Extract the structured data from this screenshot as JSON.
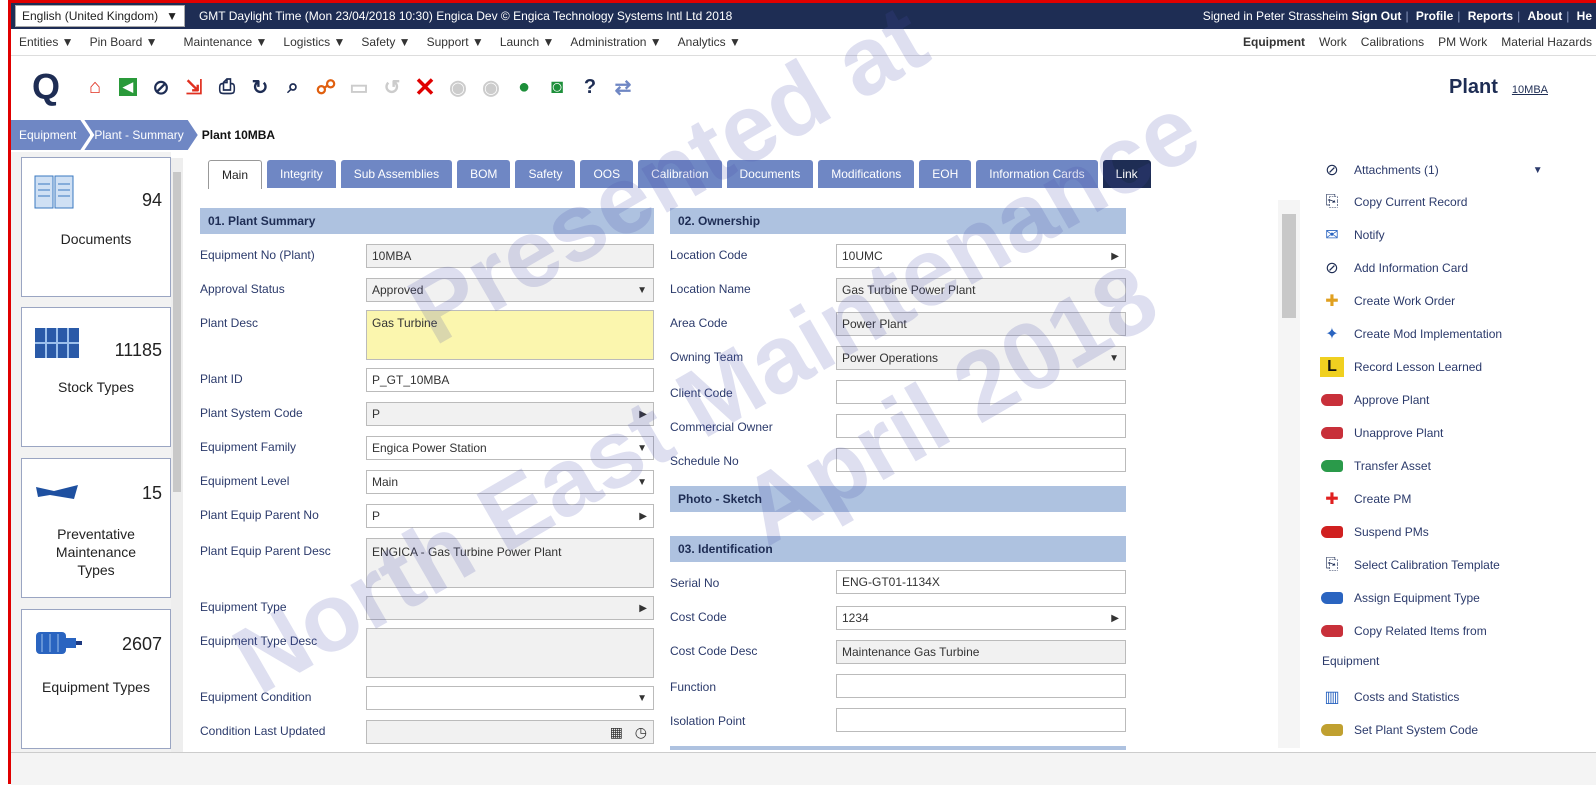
{
  "topbar": {
    "language": "English (United Kingdom)",
    "timezone_info": "GMT Daylight Time (Mon 23/04/2018 10:30) Engica Dev © Engica Technology Systems Intl Ltd 2018",
    "signed_in": "Signed in Peter Strassheim",
    "sign_out": "Sign Out",
    "profile": "Profile",
    "reports": "Reports",
    "about": "About",
    "help": "He"
  },
  "menubar": {
    "left": [
      "Entities ▼",
      "Pin Board ▼",
      "Maintenance ▼",
      "Logistics ▼",
      "Safety ▼",
      "Support ▼",
      "Launch ▼",
      "Administration ▼",
      "Analytics ▼"
    ],
    "right": [
      "Equipment",
      "Work",
      "Calibrations",
      "PM Work",
      "Material Hazards"
    ]
  },
  "toolbar": {
    "logo": "Q",
    "page_title": "Plant",
    "page_subtitle": "10MBA"
  },
  "breadcrumb": [
    "Equipment",
    "Plant - Summary",
    "Plant 10MBA"
  ],
  "tiles": [
    {
      "count": "94",
      "name": "Documents"
    },
    {
      "count": "11185",
      "name": "Stock Types"
    },
    {
      "count": "15",
      "name": "Preventative Maintenance Types"
    },
    {
      "count": "2607",
      "name": "Equipment Types"
    }
  ],
  "tabs": [
    "Main",
    "Integrity",
    "Sub Assemblies",
    "BOM",
    "Safety",
    "OOS",
    "Calibration",
    "Documents",
    "Modifications",
    "EOH",
    "Information Cards",
    "Link"
  ],
  "summary": {
    "title": "01. Plant Summary",
    "equipment_no_label": "Equipment No (Plant)",
    "equipment_no": "10MBA",
    "approval_status_label": "Approval Status",
    "approval_status": "Approved",
    "plant_desc_label": "Plant Desc",
    "plant_desc": "Gas Turbine",
    "plant_id_label": "Plant ID",
    "plant_id": "P_GT_10MBA",
    "plant_system_code_label": "Plant System Code",
    "plant_system_code": "P",
    "equipment_family_label": "Equipment Family",
    "equipment_family": "Engica Power Station",
    "equipment_level_label": "Equipment Level",
    "equipment_level": "Main",
    "parent_no_label": "Plant Equip Parent No",
    "parent_no": "P",
    "parent_desc_label": "Plant Equip Parent Desc",
    "parent_desc": "ENGICA - Gas Turbine Power Plant",
    "equipment_type_label": "Equipment Type",
    "equipment_type": "",
    "equipment_type_desc_label": "Equipment Type Desc",
    "equipment_type_desc": "",
    "equipment_condition_label": "Equipment Condition",
    "equipment_condition": "",
    "condition_updated_label": "Condition Last Updated",
    "condition_updated": ""
  },
  "ownership": {
    "title": "02. Ownership",
    "location_code_label": "Location Code",
    "location_code": "10UMC",
    "location_name_label": "Location Name",
    "location_name": "Gas Turbine Power Plant",
    "area_code_label": "Area Code",
    "area_code": "Power Plant",
    "owning_team_label": "Owning Team",
    "owning_team": "Power Operations",
    "client_code_label": "Client Code",
    "client_code": "",
    "commercial_owner_label": "Commercial Owner",
    "commercial_owner": "",
    "schedule_no_label": "Schedule No",
    "schedule_no": ""
  },
  "photo": {
    "title": "Photo - Sketch"
  },
  "identification": {
    "title": "03. Identification",
    "serial_no_label": "Serial No",
    "serial_no": "ENG-GT01-1134X",
    "cost_code_label": "Cost Code",
    "cost_code": "1234",
    "cost_code_desc_label": "Cost Code Desc",
    "cost_code_desc": "Maintenance Gas Turbine",
    "function_label": "Function",
    "function": "",
    "isolation_point_label": "Isolation Point",
    "isolation_point": ""
  },
  "actions": [
    "Attachments (1)",
    "Copy Current Record",
    "Notify",
    "Add Information Card",
    "Create Work Order",
    "Create Mod Implementation",
    "Record Lesson Learned",
    "Approve Plant",
    "Unapprove Plant",
    "Transfer Asset",
    "Create PM",
    "Suspend PMs",
    "Select Calibration Template",
    "Assign Equipment Type",
    "Copy Related Items from",
    "Equipment",
    "Costs and Statistics",
    "Set Plant System Code"
  ],
  "watermark": [
    "Presented at",
    "North East Maintenance",
    "April 2018"
  ],
  "colors": {
    "navy": "#1e2d54",
    "tab_blue": "#6f87c4",
    "section_blue": "#aec2e0",
    "highlight": "#fbf6ae",
    "border_red": "#e00000"
  }
}
